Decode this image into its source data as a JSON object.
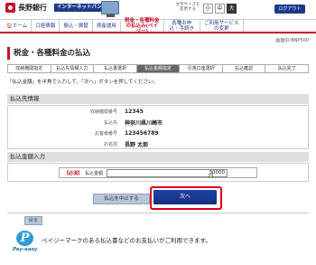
{
  "header": {
    "bank_name": "長野銀行",
    "service_badge": "インターネットバンキング",
    "font_size_label": "文字サイズを変更する",
    "font_sizes": [
      "小",
      "中",
      "大"
    ],
    "font_size_selected": "大",
    "logout": "ログアウト"
  },
  "nav": {
    "items": [
      {
        "label": "ホーム"
      },
      {
        "label": "口座情報"
      },
      {
        "label": "振込・振替"
      },
      {
        "label": "資産運用"
      },
      {
        "label": "税金・各種料金の払込み(ペイジー)"
      },
      {
        "label": "各種お申込・手続き"
      },
      {
        "label": "ご利用サービスの変更"
      }
    ]
  },
  "screen_id": "画面ID:BNP500",
  "page": {
    "title": "税金・各種料金の払込",
    "instruction": "「払込金額」を半角で入力して、「次へ」ボタンを押してください。"
  },
  "steps": [
    {
      "label": "収納機関指定"
    },
    {
      "label": "払込先情報入力"
    },
    {
      "label": "払込書選択"
    },
    {
      "label": "払込金額指定"
    },
    {
      "label": "引落口座選択"
    },
    {
      "label": "払込確認"
    },
    {
      "label": "払込完了"
    }
  ],
  "active_step": 3,
  "payee_info": {
    "section_title": "払込先情報",
    "rows": [
      {
        "label": "収納機関番号",
        "value": "12345"
      },
      {
        "label": "払込先",
        "value": "神奈川県川崎市"
      },
      {
        "label": "お客様番号",
        "value": "123456789"
      },
      {
        "label": "お名前",
        "value": "長野 太郎"
      }
    ]
  },
  "amount": {
    "section_title": "払込金額入力",
    "required_label": "【必須】",
    "field_label": "払込金額",
    "value": "30000",
    "unit": "円"
  },
  "buttons": {
    "cancel": "払込を中止する",
    "next": "次へ",
    "back": "戻る"
  },
  "payeasy": {
    "logo_text": "Pay-easy",
    "note": "ペイジーマークのある払込書などのお支払いがご利用できます。"
  }
}
